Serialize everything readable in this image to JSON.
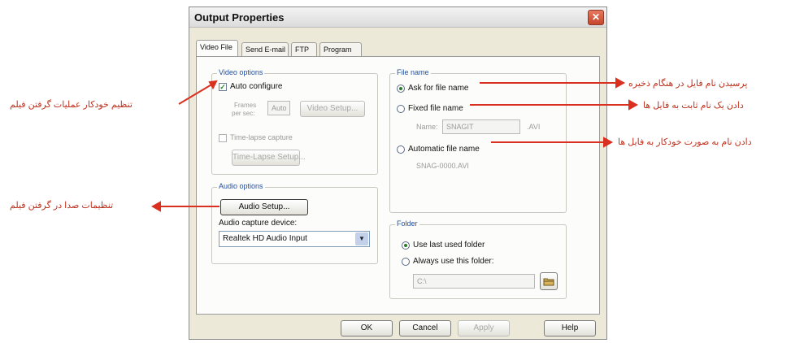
{
  "dialog": {
    "title": "Output Properties",
    "close_glyph": "✕",
    "tabs": [
      "Video File",
      "Send E-mail",
      "FTP",
      "Program"
    ],
    "video_options": {
      "legend": "Video options",
      "auto_configure": "Auto configure",
      "auto_configure_checked": true,
      "frames_label_line1": "Frames",
      "frames_label_line2": "per sec:",
      "frames_value": "Auto",
      "video_setup_button": "Video Setup...",
      "time_lapse_capture": "Time-lapse capture",
      "time_lapse_setup_button": "Time-Lapse Setup..."
    },
    "audio_options": {
      "legend": "Audio options",
      "audio_setup_button": "Audio Setup...",
      "capture_device_label": "Audio capture device:",
      "capture_device_value": "Realtek HD Audio Input"
    },
    "file_name": {
      "legend": "File name",
      "ask_for_file_name": "Ask for file name",
      "fixed_file_name": "Fixed file name",
      "name_label": "Name:",
      "name_value": "SNAGIT",
      "name_ext": ".AVI",
      "automatic_file_name": "Automatic file name",
      "auto_pattern": "SNAG-0000.AVI",
      "selected": "ask"
    },
    "folder": {
      "legend": "Folder",
      "use_last_used_folder": "Use last used folder",
      "always_use_this_folder": "Always use this folder:",
      "folder_value": "C:\\",
      "selected": "last"
    },
    "footer": {
      "ok": "OK",
      "cancel": "Cancel",
      "apply": "Apply",
      "help": "Help"
    }
  },
  "annotations": {
    "auto_configure": "تنظیم خودکار عملیات گرفتن فیلم",
    "audio_setup": "تنظیمات صدا در گرفتن فیلم",
    "ask_for_file_name": "پرسیدن نام فایل در هنگام ذخیره",
    "fixed_file_name": "دادن یک نام ثابت به فایل ها",
    "automatic_file_name": "دادن نام به صورت خودکار به فایل ها"
  },
  "colors": {
    "annotation": "#c0311f",
    "dialog_bg": "#ece9d8",
    "legend": "#2450a0"
  }
}
